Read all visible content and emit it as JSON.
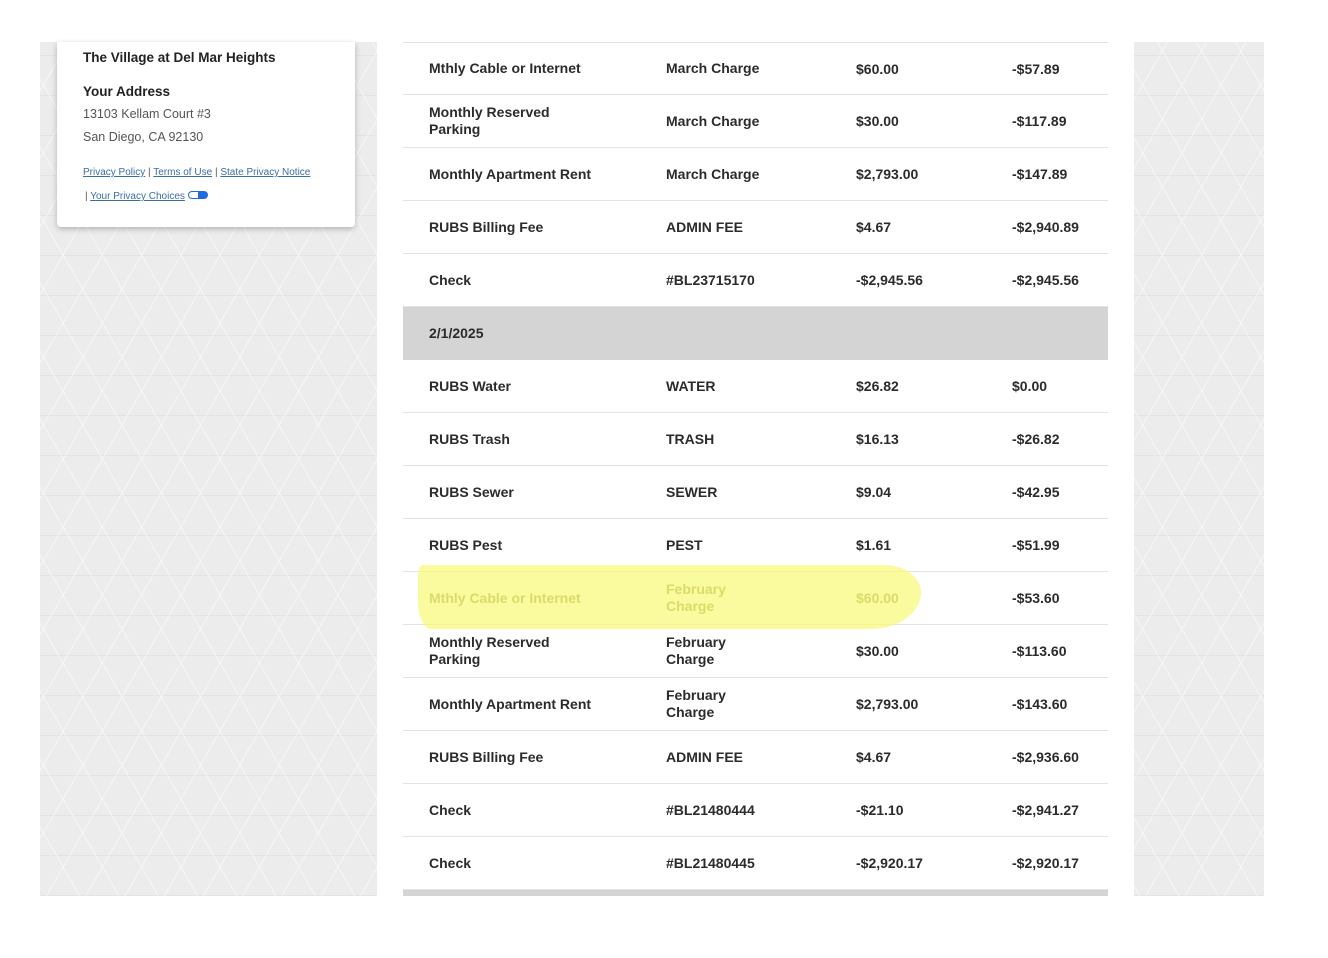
{
  "property": {
    "name": "The Village at Del Mar Heights",
    "address_heading": "Your Address",
    "address_line1": "13103 Kellam Court #3",
    "address_line2": "San Diego, CA 92130"
  },
  "footer_links": {
    "privacy_policy": "Privacy Policy",
    "terms_of_use": "Terms of Use",
    "state_privacy_notice": "State Privacy Notice",
    "privacy_choices": "Your Privacy Choices",
    "separator": "|"
  },
  "ledger": {
    "rows_a": [
      {
        "desc": "Mthly Cable or Internet",
        "ref": "March Charge",
        "amount": "$60.00",
        "balance": "-$57.89"
      },
      {
        "desc": "Monthly Reserved Parking",
        "ref": "March Charge",
        "amount": "$30.00",
        "balance": "-$117.89"
      },
      {
        "desc": "Monthly Apartment Rent",
        "ref": "March Charge",
        "amount": "$2,793.00",
        "balance": "-$147.89"
      },
      {
        "desc": "RUBS Billing Fee",
        "ref": "ADMIN FEE",
        "amount": "$4.67",
        "balance": "-$2,940.89"
      },
      {
        "desc": "Check",
        "ref": "#BL23715170",
        "amount": "-$2,945.56",
        "balance": "-$2,945.56"
      }
    ],
    "date_group": "2/1/2025",
    "rows_b": [
      {
        "desc": "RUBS Water",
        "ref": "WATER",
        "amount": "$26.82",
        "balance": "$0.00"
      },
      {
        "desc": "RUBS Trash",
        "ref": "TRASH",
        "amount": "$16.13",
        "balance": "-$26.82"
      },
      {
        "desc": "RUBS Sewer",
        "ref": "SEWER",
        "amount": "$9.04",
        "balance": "-$42.95"
      },
      {
        "desc": "RUBS Pest",
        "ref": "PEST",
        "amount": "$1.61",
        "balance": "-$51.99"
      },
      {
        "desc": "Mthly Cable or Internet",
        "ref": "February Charge",
        "amount": "$60.00",
        "balance": "-$53.60"
      },
      {
        "desc": "Monthly Reserved Parking",
        "ref": "February Charge",
        "amount": "$30.00",
        "balance": "-$113.60"
      },
      {
        "desc": "Monthly Apartment Rent",
        "ref": "February Charge",
        "amount": "$2,793.00",
        "balance": "-$143.60"
      },
      {
        "desc": "RUBS Billing Fee",
        "ref": "ADMIN FEE",
        "amount": "$4.67",
        "balance": "-$2,936.60"
      },
      {
        "desc": "Check",
        "ref": "#BL21480444",
        "amount": "-$21.10",
        "balance": "-$2,941.27"
      },
      {
        "desc": "Check",
        "ref": "#BL21480445",
        "amount": "-$2,920.17",
        "balance": "-$2,920.17"
      }
    ]
  },
  "colors": {
    "highlight": "#f8f878",
    "date_row_bg": "#d4d4d4",
    "link": "#3a6ea5",
    "privacy_badge": "#1f6be0"
  }
}
